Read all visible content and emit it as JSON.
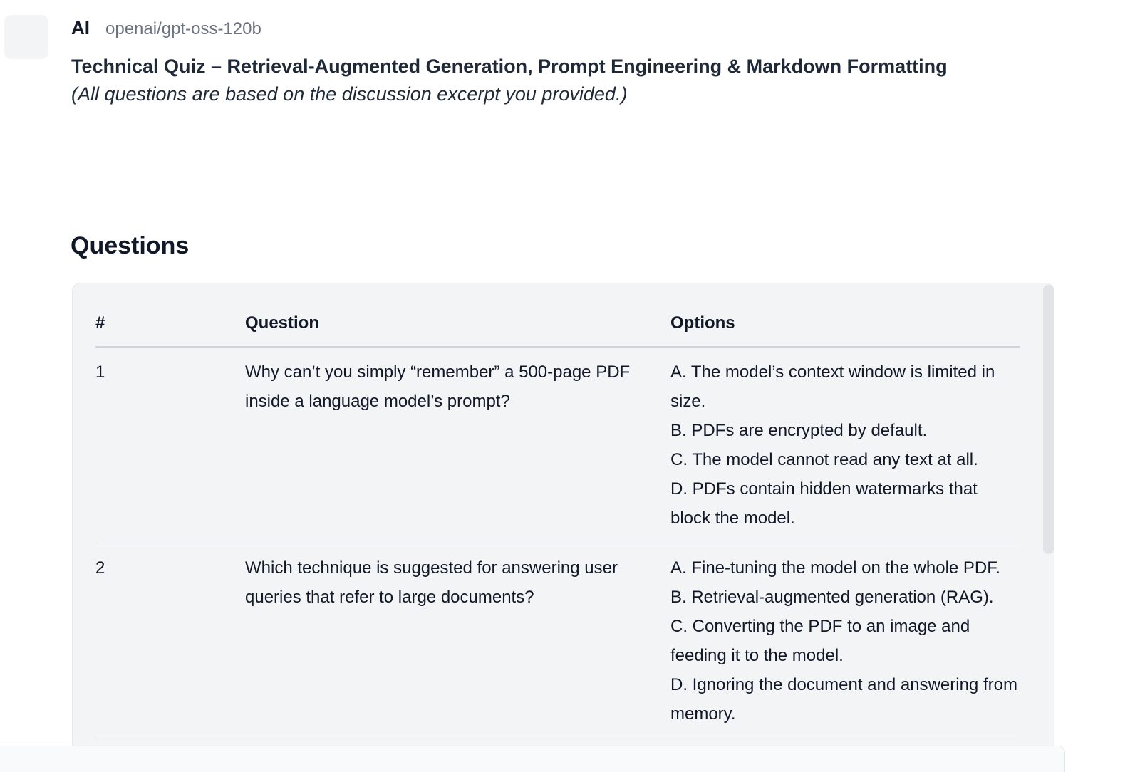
{
  "message": {
    "sender": "AI",
    "model": "openai/gpt-oss-120b"
  },
  "quiz": {
    "title": "Technical Quiz – Retrieval-Augmented Generation, Prompt Engineering & Markdown Formatting",
    "subtitle": "(All questions are based on the discussion excerpt you provided.)"
  },
  "section": {
    "heading": "Questions"
  },
  "table": {
    "headers": {
      "num": "#",
      "question": "Question",
      "options": "Options"
    },
    "rows": [
      {
        "num": "1",
        "question": "Why can’t you simply “remember” a 500-page PDF inside a language model’s prompt?",
        "options": [
          "A. The model’s context window is limited in size.",
          "B. PDFs are encrypted by default.",
          "C. The model cannot read any text at all.",
          "D. PDFs contain hidden watermarks that block the model."
        ]
      },
      {
        "num": "2",
        "question": "Which technique is suggested for answering user queries that refer to large documents?",
        "options": [
          "A. Fine-tuning the model on the whole PDF.",
          "B. Retrieval-augmented generation (RAG).",
          "C. Converting the PDF to an image and feeding it to the model.",
          "D. Ignoring the document and answering from memory."
        ]
      }
    ]
  }
}
